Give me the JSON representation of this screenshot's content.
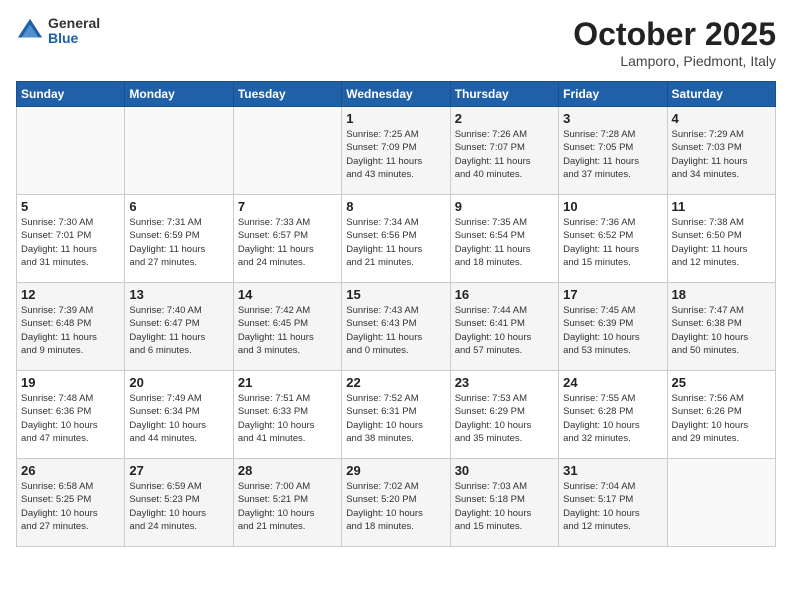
{
  "header": {
    "logo": {
      "general": "General",
      "blue": "Blue"
    },
    "title": "October 2025",
    "location": "Lamporo, Piedmont, Italy"
  },
  "weekdays": [
    "Sunday",
    "Monday",
    "Tuesday",
    "Wednesday",
    "Thursday",
    "Friday",
    "Saturday"
  ],
  "weeks": [
    [
      {
        "day": "",
        "info": ""
      },
      {
        "day": "",
        "info": ""
      },
      {
        "day": "",
        "info": ""
      },
      {
        "day": "1",
        "info": "Sunrise: 7:25 AM\nSunset: 7:09 PM\nDaylight: 11 hours\nand 43 minutes."
      },
      {
        "day": "2",
        "info": "Sunrise: 7:26 AM\nSunset: 7:07 PM\nDaylight: 11 hours\nand 40 minutes."
      },
      {
        "day": "3",
        "info": "Sunrise: 7:28 AM\nSunset: 7:05 PM\nDaylight: 11 hours\nand 37 minutes."
      },
      {
        "day": "4",
        "info": "Sunrise: 7:29 AM\nSunset: 7:03 PM\nDaylight: 11 hours\nand 34 minutes."
      }
    ],
    [
      {
        "day": "5",
        "info": "Sunrise: 7:30 AM\nSunset: 7:01 PM\nDaylight: 11 hours\nand 31 minutes."
      },
      {
        "day": "6",
        "info": "Sunrise: 7:31 AM\nSunset: 6:59 PM\nDaylight: 11 hours\nand 27 minutes."
      },
      {
        "day": "7",
        "info": "Sunrise: 7:33 AM\nSunset: 6:57 PM\nDaylight: 11 hours\nand 24 minutes."
      },
      {
        "day": "8",
        "info": "Sunrise: 7:34 AM\nSunset: 6:56 PM\nDaylight: 11 hours\nand 21 minutes."
      },
      {
        "day": "9",
        "info": "Sunrise: 7:35 AM\nSunset: 6:54 PM\nDaylight: 11 hours\nand 18 minutes."
      },
      {
        "day": "10",
        "info": "Sunrise: 7:36 AM\nSunset: 6:52 PM\nDaylight: 11 hours\nand 15 minutes."
      },
      {
        "day": "11",
        "info": "Sunrise: 7:38 AM\nSunset: 6:50 PM\nDaylight: 11 hours\nand 12 minutes."
      }
    ],
    [
      {
        "day": "12",
        "info": "Sunrise: 7:39 AM\nSunset: 6:48 PM\nDaylight: 11 hours\nand 9 minutes."
      },
      {
        "day": "13",
        "info": "Sunrise: 7:40 AM\nSunset: 6:47 PM\nDaylight: 11 hours\nand 6 minutes."
      },
      {
        "day": "14",
        "info": "Sunrise: 7:42 AM\nSunset: 6:45 PM\nDaylight: 11 hours\nand 3 minutes."
      },
      {
        "day": "15",
        "info": "Sunrise: 7:43 AM\nSunset: 6:43 PM\nDaylight: 11 hours\nand 0 minutes."
      },
      {
        "day": "16",
        "info": "Sunrise: 7:44 AM\nSunset: 6:41 PM\nDaylight: 10 hours\nand 57 minutes."
      },
      {
        "day": "17",
        "info": "Sunrise: 7:45 AM\nSunset: 6:39 PM\nDaylight: 10 hours\nand 53 minutes."
      },
      {
        "day": "18",
        "info": "Sunrise: 7:47 AM\nSunset: 6:38 PM\nDaylight: 10 hours\nand 50 minutes."
      }
    ],
    [
      {
        "day": "19",
        "info": "Sunrise: 7:48 AM\nSunset: 6:36 PM\nDaylight: 10 hours\nand 47 minutes."
      },
      {
        "day": "20",
        "info": "Sunrise: 7:49 AM\nSunset: 6:34 PM\nDaylight: 10 hours\nand 44 minutes."
      },
      {
        "day": "21",
        "info": "Sunrise: 7:51 AM\nSunset: 6:33 PM\nDaylight: 10 hours\nand 41 minutes."
      },
      {
        "day": "22",
        "info": "Sunrise: 7:52 AM\nSunset: 6:31 PM\nDaylight: 10 hours\nand 38 minutes."
      },
      {
        "day": "23",
        "info": "Sunrise: 7:53 AM\nSunset: 6:29 PM\nDaylight: 10 hours\nand 35 minutes."
      },
      {
        "day": "24",
        "info": "Sunrise: 7:55 AM\nSunset: 6:28 PM\nDaylight: 10 hours\nand 32 minutes."
      },
      {
        "day": "25",
        "info": "Sunrise: 7:56 AM\nSunset: 6:26 PM\nDaylight: 10 hours\nand 29 minutes."
      }
    ],
    [
      {
        "day": "26",
        "info": "Sunrise: 6:58 AM\nSunset: 5:25 PM\nDaylight: 10 hours\nand 27 minutes."
      },
      {
        "day": "27",
        "info": "Sunrise: 6:59 AM\nSunset: 5:23 PM\nDaylight: 10 hours\nand 24 minutes."
      },
      {
        "day": "28",
        "info": "Sunrise: 7:00 AM\nSunset: 5:21 PM\nDaylight: 10 hours\nand 21 minutes."
      },
      {
        "day": "29",
        "info": "Sunrise: 7:02 AM\nSunset: 5:20 PM\nDaylight: 10 hours\nand 18 minutes."
      },
      {
        "day": "30",
        "info": "Sunrise: 7:03 AM\nSunset: 5:18 PM\nDaylight: 10 hours\nand 15 minutes."
      },
      {
        "day": "31",
        "info": "Sunrise: 7:04 AM\nSunset: 5:17 PM\nDaylight: 10 hours\nand 12 minutes."
      },
      {
        "day": "",
        "info": ""
      }
    ]
  ]
}
